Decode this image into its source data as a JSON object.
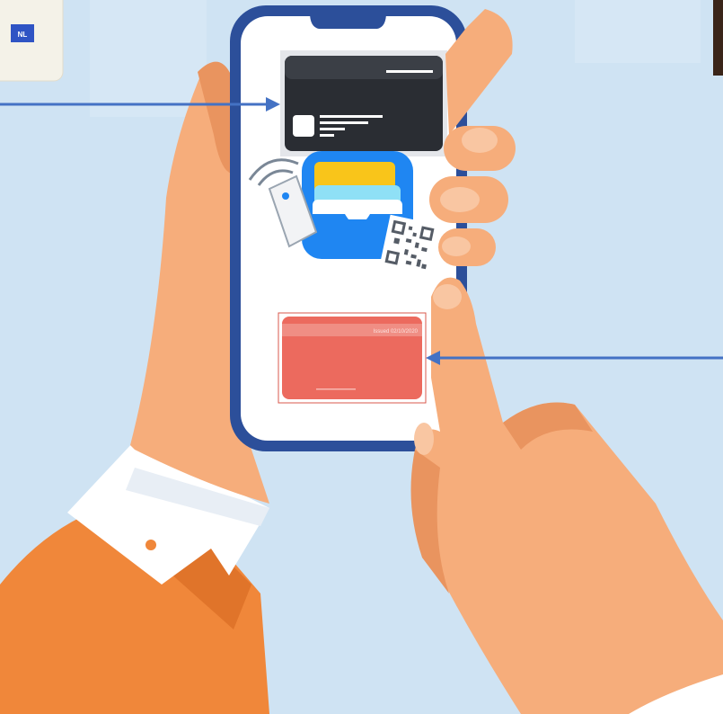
{
  "colors": {
    "background": "#cfe3f3",
    "phone_frame": "#2c4f9a",
    "phone_screen": "#ffffff",
    "skin": "#f6ad7b",
    "sleeve": "#f0873a",
    "cuff": "#ffffff",
    "arrow": "#4472c4",
    "dark_card": "#2a2d33",
    "red_card": "#ec6a5e"
  },
  "eu_card": {
    "country_code": "NL"
  },
  "red_card": {
    "issued_text": "Issued 02/10/2020"
  },
  "icons": [
    "id-card-icon",
    "nfc-reader-icon",
    "wallet-app-icon",
    "qr-code-icon",
    "arrow-right-icon",
    "arrow-left-icon"
  ]
}
